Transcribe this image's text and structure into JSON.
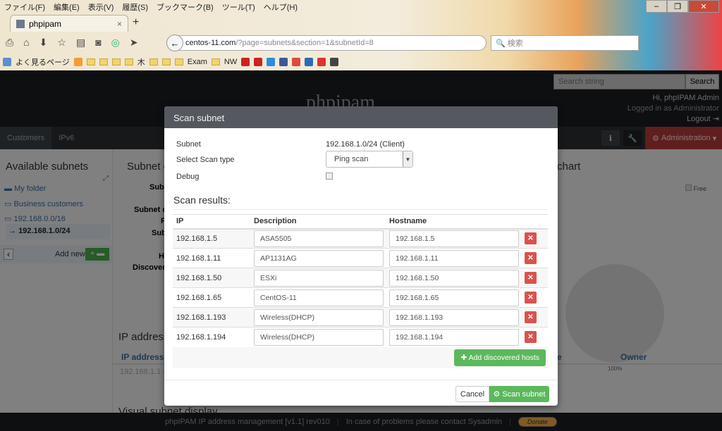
{
  "browser": {
    "menu": [
      "ファイル(F)",
      "編集(E)",
      "表示(V)",
      "履歴(S)",
      "ブックマーク(B)",
      "ツール(T)",
      "ヘルプ(H)"
    ],
    "tab_title": "phpipam",
    "url_host": "centos-11.com",
    "url_path": "/?page=subnets&section=1&subnetId=8",
    "search_placeholder": "検索",
    "bookmarks": [
      "よく見るページ",
      "木",
      "Exam",
      "NW"
    ]
  },
  "header": {
    "brand": "phpipam",
    "search_placeholder": "Search string",
    "search_button": "Search",
    "greeting": "Hi, phpIPAM Admin",
    "logged_in": "Logged in as  Administrator",
    "logout": "Logout"
  },
  "nav": {
    "tabs": [
      "Customers",
      "IPv6"
    ],
    "admin": "Administration"
  },
  "sidebar": {
    "title": "Available subnets",
    "items": [
      "My folder",
      "Business customers",
      "192.168.0.0/16",
      "192.168.1.0/24"
    ],
    "add_new": "Add new"
  },
  "background": {
    "subnet_title": "Subnet d",
    "labels": [
      "Subn",
      "Subnet d",
      "F",
      "Sub",
      "H",
      "Discover"
    ],
    "chart_title": "chart",
    "legend_free": "Free",
    "pie_label": "100%",
    "ip_section": "IP address",
    "col_ip": "IP address",
    "col_e": "e",
    "col_owner": "Owner",
    "row_ip": "192.168.1.1 -",
    "visual": "Visual subnet display"
  },
  "modal": {
    "title": "Scan subnet",
    "subnet_label": "Subnet",
    "subnet_value": "192.168.1.0/24 (Client)",
    "scan_type_label": "Select Scan type",
    "scan_type_value": "Ping scan",
    "debug_label": "Debug",
    "debug_checked": false,
    "results_title": "Scan results:",
    "columns": [
      "IP",
      "Description",
      "Hostname"
    ],
    "rows": [
      {
        "ip": "192.168.1.5",
        "description": "ASA5505",
        "hostname": "192.168.1.5"
      },
      {
        "ip": "192.168.1.11",
        "description": "AP1131AG",
        "hostname": "192.168.1.11"
      },
      {
        "ip": "192.168.1.50",
        "description": "ESXi",
        "hostname": "192.168.1.50"
      },
      {
        "ip": "192.168.1.65",
        "description": "CentOS-11",
        "hostname": "192.168.1.65"
      },
      {
        "ip": "192.168.1.193",
        "description": "Wireless(DHCP)",
        "hostname": "192.168.1.193"
      },
      {
        "ip": "192.168.1.194",
        "description": "Wireless(DHCP)",
        "hostname": "192.168.1.194"
      }
    ],
    "add_hosts": "Add discovered hosts",
    "cancel": "Cancel",
    "scan": "Scan subnet"
  },
  "footer": {
    "version": "phpIPAM IP address management [v1.1] rev010",
    "contact": "In case of problems please contact Sysadmin",
    "donate": "Donate"
  },
  "colors": {
    "accent_green": "#5cb85c",
    "danger": "#d9534f",
    "admin": "#b93a3a"
  }
}
